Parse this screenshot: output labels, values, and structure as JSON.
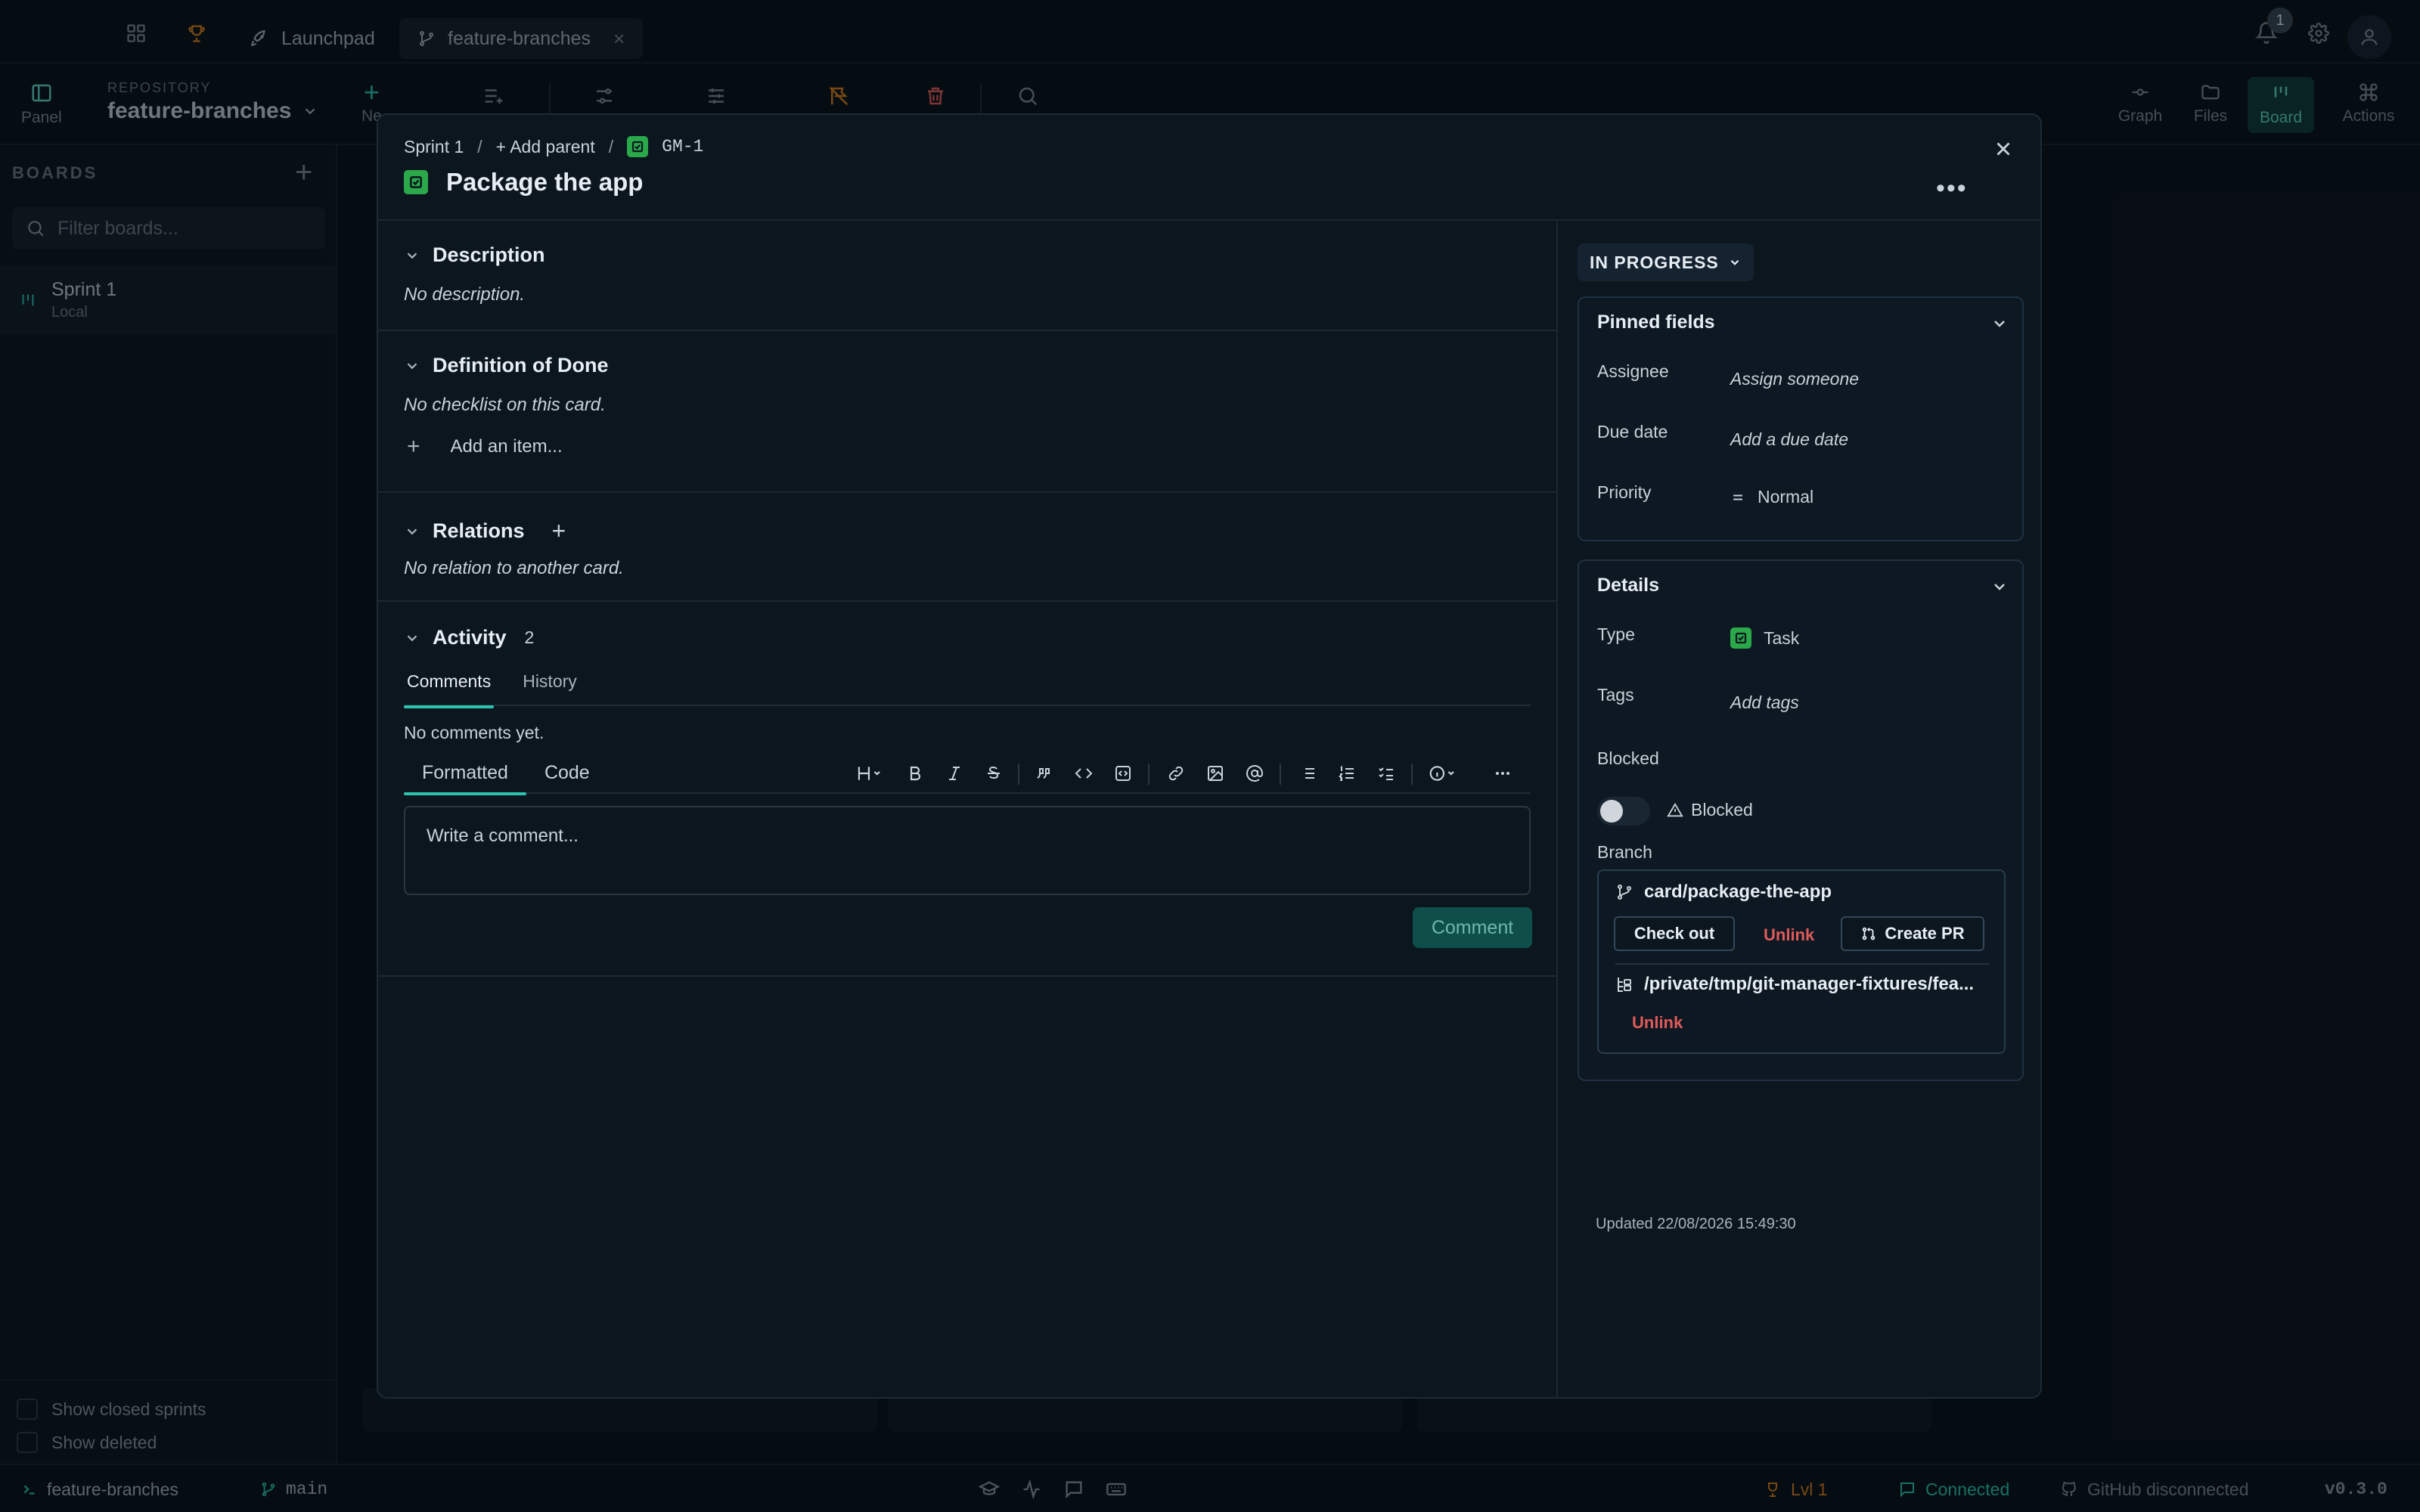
{
  "titlebar": {
    "tabs": [
      {
        "label": "Launchpad",
        "icon": "rocket-icon"
      },
      {
        "label": "feature-branches",
        "icon": "git-branch-icon"
      }
    ],
    "notifications_count": "1"
  },
  "toolbar": {
    "panel_label": "Panel",
    "repo_label": "REPOSITORY",
    "repo_name": "feature-branches",
    "new_label": "Ne",
    "right_tools": [
      {
        "label": "Graph"
      },
      {
        "label": "Files"
      },
      {
        "label": "Board"
      },
      {
        "label": "Actions"
      }
    ]
  },
  "sidebar": {
    "title": "BOARDS",
    "filter_placeholder": "Filter boards...",
    "boards": [
      {
        "name": "Sprint 1",
        "sub": "Local"
      }
    ],
    "show_closed": "Show closed sprints",
    "show_deleted": "Show deleted"
  },
  "statusbar": {
    "repo": "feature-branches",
    "branch": "main",
    "level": "Lvl 1",
    "connection": "Connected",
    "github": "GitHub disconnected",
    "version": "v0.3.0"
  },
  "modal": {
    "breadcrumb": {
      "sprint": "Sprint 1",
      "sep": "/",
      "add_parent": "+ Add parent",
      "key": "GM-1"
    },
    "title": "Package the app",
    "description": {
      "heading": "Description",
      "empty": "No description."
    },
    "dod": {
      "heading": "Definition of Done",
      "empty": "No checklist on this card.",
      "add": "Add an item..."
    },
    "relations": {
      "heading": "Relations",
      "empty": "No relation to another card."
    },
    "activity": {
      "heading": "Activity",
      "count": "2",
      "tabs": [
        "Comments",
        "History"
      ],
      "empty": "No comments yet.",
      "editor_tabs": [
        "Formatted",
        "Code"
      ],
      "placeholder": "Write a comment...",
      "submit": "Comment"
    },
    "status": "IN PROGRESS",
    "pinned": {
      "heading": "Pinned fields",
      "assignee_label": "Assignee",
      "assignee_value": "Assign someone",
      "due_label": "Due date",
      "due_value": "Add a due date",
      "priority_label": "Priority",
      "priority_value": "Normal"
    },
    "details": {
      "heading": "Details",
      "type_label": "Type",
      "type_value": "Task",
      "tags_label": "Tags",
      "tags_value": "Add tags",
      "blocked_label": "Blocked",
      "blocked_value": "Blocked",
      "branch_label": "Branch",
      "branch_name": "card/package-the-app",
      "checkout": "Check out",
      "unlink": "Unlink",
      "create_pr": "Create PR",
      "worktree": "/private/tmp/git-manager-fixtures/fea...",
      "unlink2": "Unlink"
    },
    "updated": "Updated 22/08/2026 15:49:30"
  },
  "colors": {
    "accent": "#2cc4ae",
    "task": "#2aa84a",
    "danger": "#e05a5a",
    "warning": "#d97a1e"
  }
}
